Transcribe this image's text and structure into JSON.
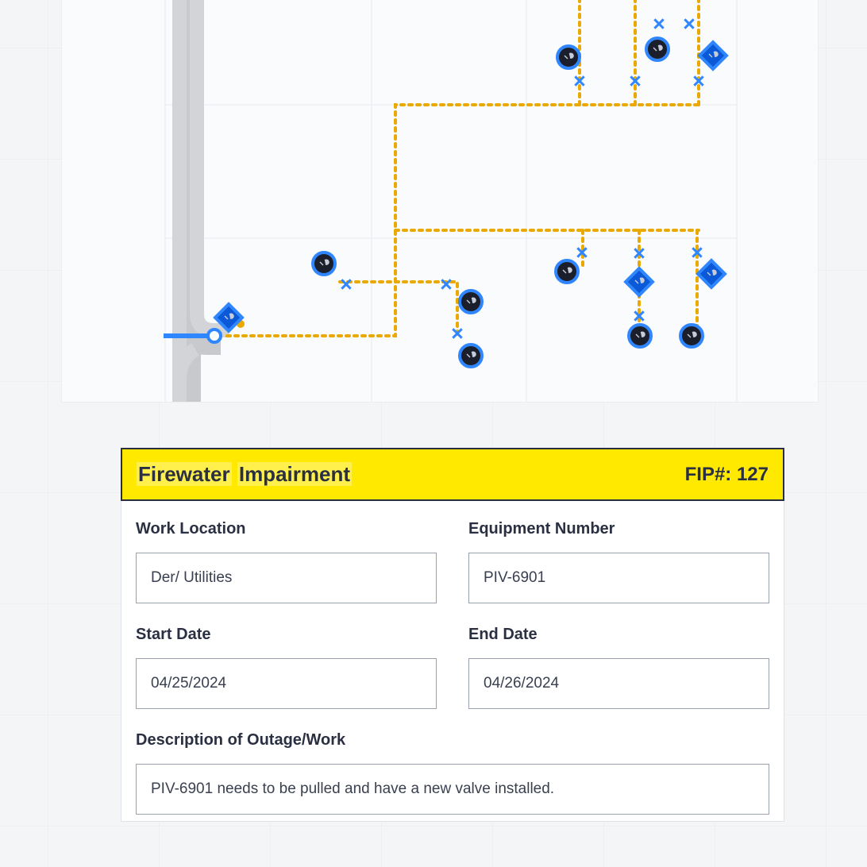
{
  "form": {
    "title_part1": "Firewater",
    "title_part2": "Impairment",
    "fip_label": "FIP#: 127",
    "fields": {
      "work_location": {
        "label": "Work Location",
        "value": "Der/ Utilities"
      },
      "equipment_number": {
        "label": "Equipment Number",
        "value": "PIV-6901"
      },
      "start_date": {
        "label": "Start Date",
        "value": "04/25/2024"
      },
      "end_date": {
        "label": "End Date",
        "value": "04/26/2024"
      },
      "description": {
        "label": "Description of Outage/Work",
        "value": "PIV-6901 needs to be pulled and have a new valve installed."
      }
    }
  }
}
